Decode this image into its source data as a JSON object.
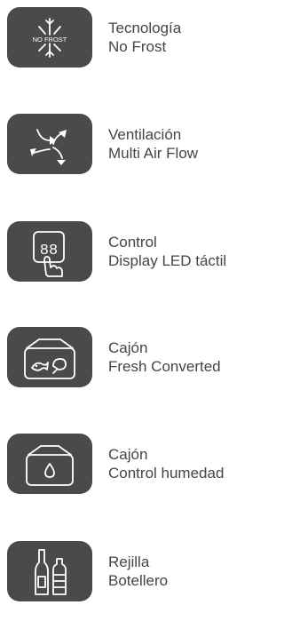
{
  "features": [
    {
      "icon": "snowflake-no-frost-icon",
      "icon_text": "NO FROST",
      "line1": "Tecnología",
      "line2": "No Frost"
    },
    {
      "icon": "multi-air-flow-arrows-icon",
      "line1": "Ventilación",
      "line2": "Multi Air Flow"
    },
    {
      "icon": "led-touch-display-icon",
      "icon_text": "88",
      "line1": "Control",
      "line2": "Display LED táctil"
    },
    {
      "icon": "fresh-drawer-fish-chicken-icon",
      "line1": "Cajón",
      "line2": "Fresh Converted"
    },
    {
      "icon": "humidity-drawer-drop-icon",
      "line1": "Cajón",
      "line2": "Control humedad"
    },
    {
      "icon": "bottle-rack-icon",
      "line1": "Rejilla",
      "line2": "Botellero"
    }
  ],
  "colors": {
    "tile": "#4a4a4a",
    "text": "#454545",
    "icon": "#ffffff"
  }
}
